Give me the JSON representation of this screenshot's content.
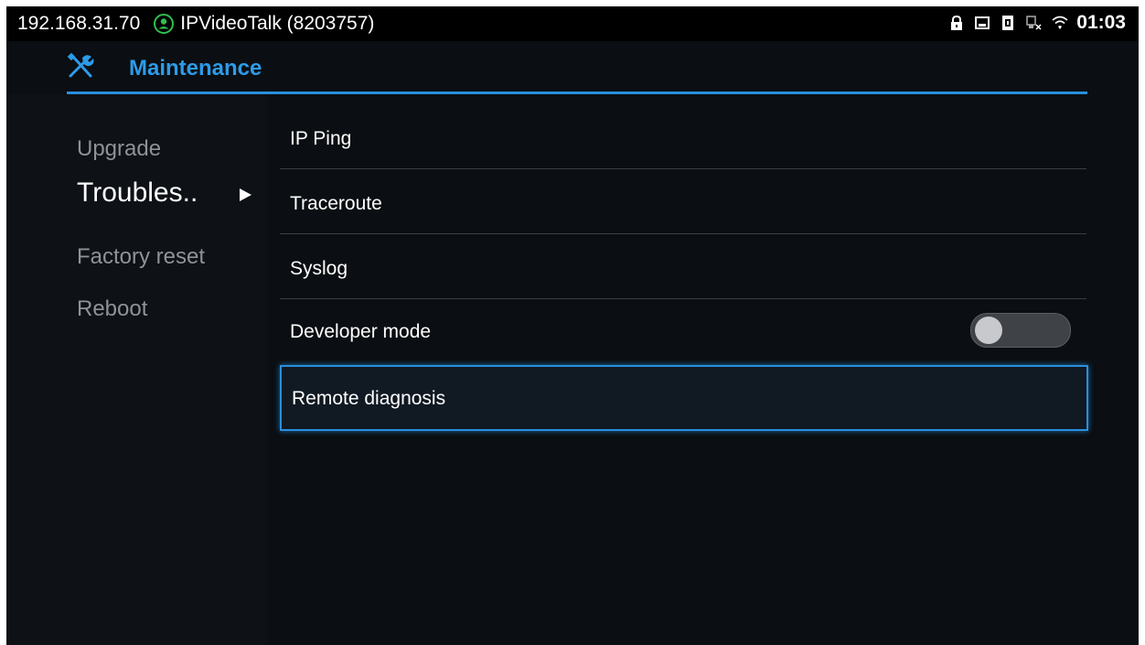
{
  "status_bar": {
    "ip": "192.168.31.70",
    "account": "IPVideoTalk (8203757)",
    "time": "01:03",
    "icons": [
      "contact-icon",
      "lock-icon",
      "image-icon",
      "sim-icon",
      "ethernet-icon",
      "wifi-icon"
    ]
  },
  "header": {
    "title": "Maintenance",
    "icon": "tools-icon"
  },
  "sidebar": {
    "items": [
      {
        "label": "Upgrade"
      },
      {
        "label": "Troubles.."
      },
      {
        "label": "Factory reset"
      },
      {
        "label": "Reboot"
      }
    ],
    "active_index": 1
  },
  "main": {
    "rows": [
      {
        "label": "IP Ping"
      },
      {
        "label": "Traceroute"
      },
      {
        "label": "Syslog"
      },
      {
        "label": "Developer mode",
        "toggle": "off"
      },
      {
        "label": "Remote diagnosis",
        "selected": true
      }
    ]
  },
  "colors": {
    "accent": "#2a8fdc",
    "title": "#2d9be8",
    "background": "#0b0e12"
  }
}
